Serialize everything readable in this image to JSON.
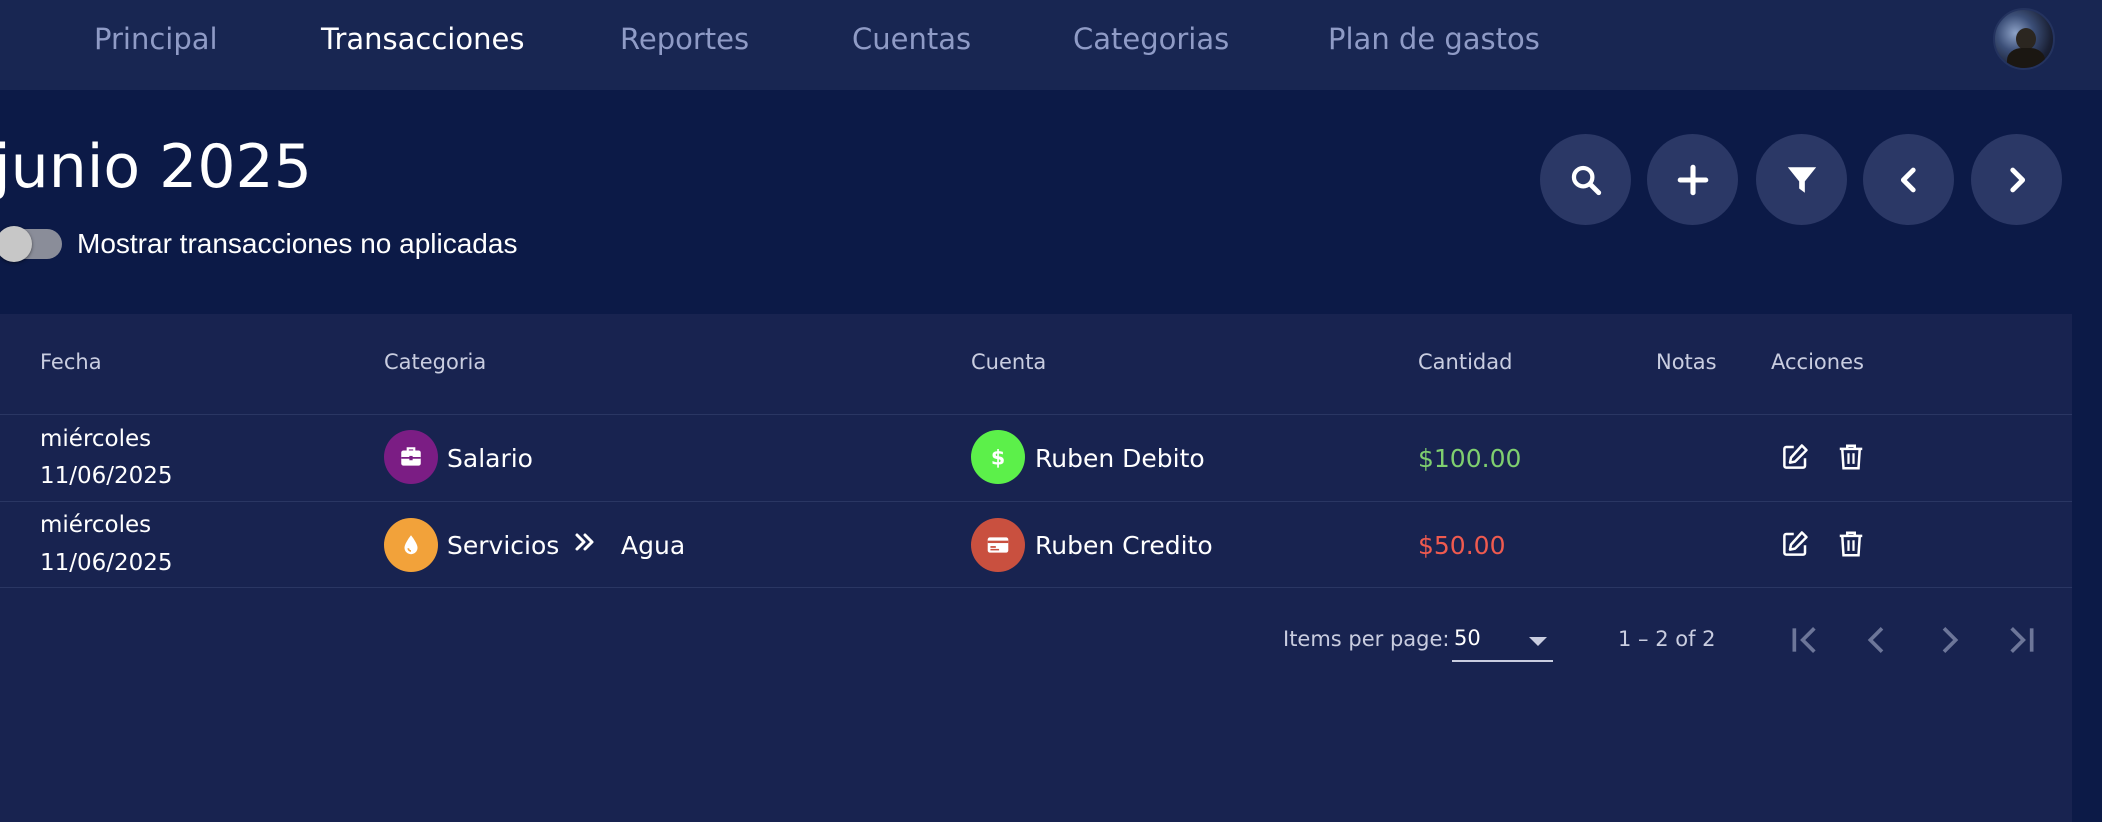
{
  "nav": {
    "items": [
      {
        "label": "Principal"
      },
      {
        "label": "Transacciones",
        "active": true
      },
      {
        "label": "Reportes"
      },
      {
        "label": "Cuentas"
      },
      {
        "label": "Categorias"
      },
      {
        "label": "Plan de gastos"
      }
    ]
  },
  "header": {
    "period": "junio 2025",
    "toggle_label": "Mostrar transacciones no aplicadas",
    "toggle_on": false
  },
  "actions": {
    "icons": [
      "search-icon",
      "plus-icon",
      "filter-icon",
      "chevron-left-icon",
      "chevron-right-icon"
    ]
  },
  "table": {
    "columns": [
      "Fecha",
      "Categoria",
      "Cuenta",
      "Cantidad",
      "Notas",
      "Acciones"
    ],
    "rows": [
      {
        "weekday": "miércoles",
        "date": "11/06/2025",
        "category": "Salario",
        "category_icon": "briefcase-icon",
        "category_color": "#7b1d84",
        "subcategory": "",
        "account": "Ruben Debito",
        "account_icon": "dollar-icon",
        "account_color": "#5cf04a",
        "amount": "$100.00",
        "amount_color": "#7fcf6f",
        "notes": ""
      },
      {
        "weekday": "miércoles",
        "date": "11/06/2025",
        "category": "Servicios",
        "category_icon": "water-drop-icon",
        "category_color": "#f2a23a",
        "subcategory": "Agua",
        "account": "Ruben Credito",
        "account_icon": "credit-card-icon",
        "account_color": "#c9503f",
        "amount": "$50.00",
        "amount_color": "#ef5a4f",
        "notes": ""
      }
    ]
  },
  "pagination": {
    "items_per_page_label": "Items per page:",
    "page_size": "50",
    "range": "1 – 2 of 2"
  },
  "colors": {
    "background": "#0c1a47",
    "navbar": "#182652",
    "panel": "#182350",
    "fab": "#2b3866"
  }
}
